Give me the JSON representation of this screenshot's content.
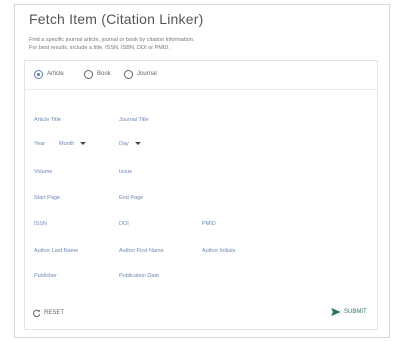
{
  "dialog": {
    "title": "Fetch Item (Citation Linker)",
    "description_line1": "Find a specific journal article, journal or book by citation information.",
    "description_line2": "For best results, include a title, ISSN, ISBN, DOI or PMID."
  },
  "type_options": [
    {
      "label": "Article",
      "checked": true
    },
    {
      "label": "Book",
      "checked": false
    },
    {
      "label": "Journal",
      "checked": false
    }
  ],
  "fields": {
    "article_title": "Article Title",
    "journal_title": "Journal Title",
    "year": "Year",
    "month": "Month",
    "day": "Day",
    "volume": "Volume",
    "issue": "Issue",
    "start_page": "Start Page",
    "end_page": "End Page",
    "issn": "ISSN",
    "doi": "DOI",
    "pmid": "PMID",
    "author_last_name": "Author Last Name",
    "author_first_name": "Author First Name",
    "author_initials": "Author Initials",
    "publisher": "Publisher",
    "publication_date": "Publication Date"
  },
  "actions": {
    "reset_label": "RESET",
    "submit_label": "SUBMIT"
  },
  "colors": {
    "accent": "#5b7fb0",
    "submit": "#2a7a55",
    "field_label": "#6a89b5"
  },
  "icons": {
    "reset": "refresh-icon",
    "submit": "send-icon"
  }
}
